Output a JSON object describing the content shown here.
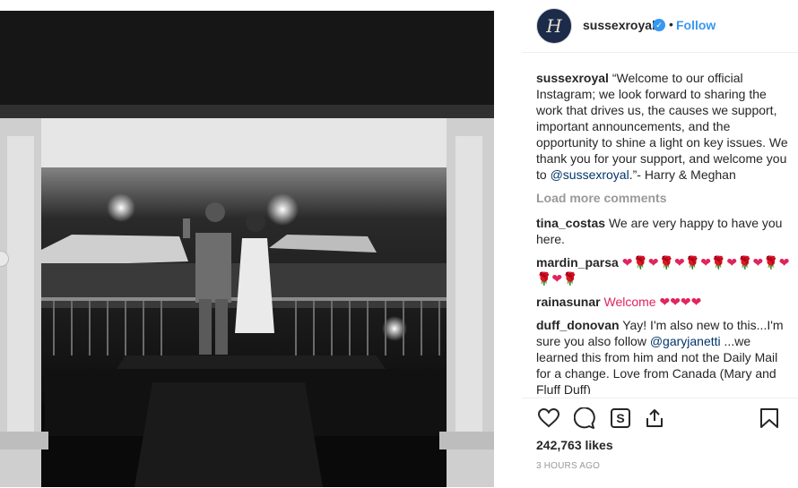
{
  "post": {
    "username": "sussexroyal",
    "follow_label": "Follow",
    "dot": "•",
    "avatar_monogram": "H",
    "caption_text": "“Welcome to our official Instagram; we look forward to sharing the work that drives us, the causes we support, important announcements, and the opportunity to shine a light on key issues. We thank you for your support, and welcome you to ",
    "caption_mention": "@sussexroyal",
    "caption_end": ".”- Harry & Meghan",
    "load_more": "Load more comments",
    "likes": "242,763 likes",
    "time": "3 HOURS AGO"
  },
  "comments": [
    {
      "user": "tina_costas",
      "text": "We are very happy to have you here."
    },
    {
      "user": "mardin_parsa",
      "text": "❤🌹❤🌹❤🌹❤🌹❤🌹❤🌹❤🌹❤🌹"
    },
    {
      "user": "rainasunar",
      "text": "Welcome ❤❤❤❤"
    },
    {
      "user": "duff_donovan",
      "text_a": "Yay! I'm also new to this...I'm sure you also follow ",
      "mention": "@garyjanetti",
      "text_b": " ...we learned this from him and not the Daily Mail for a change. Love from Canada (Mary and Fluff Duff)"
    }
  ],
  "colors": {
    "accent": "#3897f0",
    "mention": "#003569",
    "muted": "#999999",
    "text": "#262626"
  },
  "icons": [
    "heart-icon",
    "comment-icon",
    "share-icon",
    "save-icon",
    "verified-icon"
  ]
}
